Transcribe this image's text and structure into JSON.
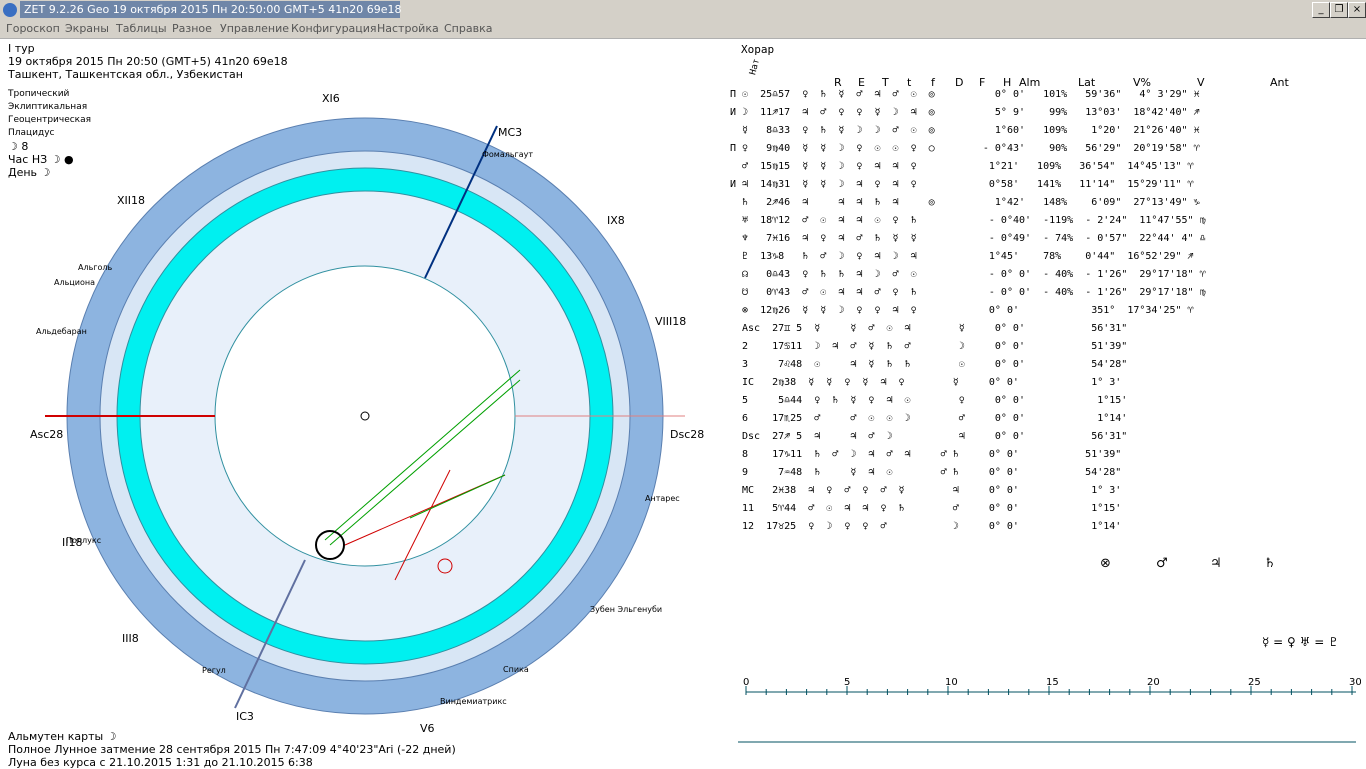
{
  "window": {
    "title": "ZET 9.2.26 Geo   19 октября 2015  Пн  20:50:00 GMT+5 41n20  69e18",
    "buttons": [
      "_",
      "❐",
      "×"
    ]
  },
  "menu": [
    "Гороскоп",
    "Экраны",
    "Таблицы",
    "Разное",
    "Управление",
    "Конфигурация",
    "Настройка",
    "Справка"
  ],
  "header": {
    "round": "I тур",
    "datetime": "19 октября 2015  Пн  20:50 (GMT+5) 41n20  69e18",
    "place": "Ташкент, Ташкентская обл., Узбекистан",
    "zodiac": "Тропический",
    "coords": "Эклиптикальная",
    "center": "Геоцентрическая",
    "houses": "Плацидус",
    "moon_day": "☽  8",
    "hour": "Час НЗ ☽ ●",
    "day": "День ☽"
  },
  "chart": {
    "house_labels": [
      "XI6",
      "MC3",
      "XII18",
      "IX8",
      "VIII18",
      "Asc28",
      "Dsc28",
      "II18",
      "III8",
      "IC3",
      "V6",
      "Зубен Эльгенуби"
    ],
    "stars": [
      "Фомальгаут",
      "Альголь",
      "Альциона",
      "Альдебаран",
      "Поллукс",
      "Регул",
      "Спика",
      "Виндемиатрикс",
      "Антарес",
      "Зубен Эльгенуби"
    ]
  },
  "horar": {
    "title": "Хорар",
    "nat_label": "Нат",
    "columns": [
      "R",
      "E",
      "T",
      "t",
      "f",
      "D",
      "F",
      "H",
      "Alm",
      "Lat",
      "V%",
      "V",
      "Ant"
    ],
    "rows": [
      "П ☉  25♎57  ♀  ♄  ☿  ♂  ♃  ♂  ☉  ◎          0° 0'   101%   59'36\"   4° 3'29\" ♓",
      "И ☽  11♐17  ♃  ♂  ♀  ♀  ☿  ☽  ♃  ◎          5° 9'    99%   13°03'  18°42'40\" ♐",
      "  ☿   8♎33  ♀  ♄  ☿  ☽  ☽  ♂  ☉  ◎          1°60'   109%    1°20'  21°26'40\" ♓",
      "П ♀   9♍40  ☿  ☿  ☽  ♀  ☉  ☉  ♀  ○        - 0°43'    90%   56'29\"  20°19'58\" ♈",
      "  ♂  15♍15  ☿  ☿  ☽  ♀  ♃  ♃  ♀            1°21'   109%   36'54\"  14°45'13\" ♈",
      "И ♃  14♍31  ☿  ☿  ☽  ♃  ♀  ♃  ♀            0°58'   141%   11'14\"  15°29'11\" ♈",
      "  ♄   2♐46  ♃     ♃  ♃  ♄  ♃     ◎          1°42'   148%    6'09\"  27°13'49\" ♑",
      "  ♅  18♈12  ♂  ☉  ♃  ♃  ☉  ♀  ♄            - 0°40'  -119%  - 2'24\"  11°47'55\" ♍",
      "  ♆   7♓16  ♃  ♀  ♃  ♂  ♄  ☿  ☿            - 0°49'  - 74%  - 0'57\"  22°44' 4\" ♎",
      "  ♇  13♑8   ♄  ♂  ☽  ♀  ♃  ☽  ♃            1°45'    78%    0'44\"  16°52'29\" ♐",
      "  ☊   0♎43  ♀  ♄  ♄  ♃  ☽  ♂  ☉            - 0° 0'  - 40%  - 1'26\"  29°17'18\" ♈",
      "  ☋   0♈43  ♂  ☉  ♃  ♃  ♂  ♀  ♄            - 0° 0'  - 40%  - 1'26\"  29°17'18\" ♍",
      "  ⊗  12♍26  ☿  ☿  ☽  ♀  ♀  ♃  ♀            0° 0'            351°  17°34'25\" ♈"
    ],
    "house_rows": [
      "Asc  27♊ 5  ☿     ☿  ♂  ☉  ♃        ☿     0° 0'           56'31\"",
      "2    17♋11  ☽  ♃  ♂  ☿  ♄  ♂        ☽     0° 0'           51'39\"",
      "3     7♌48  ☉     ♃  ☿  ♄  ♄        ☉     0° 0'           54'28\"",
      "IC   2♍38  ☿  ☿  ♀  ☿  ♃  ♀        ☿     0° 0'            1° 3'",
      "5     5♎44  ♀  ♄  ☿  ♀  ♃  ☉        ♀     0° 0'            1°15'",
      "6    17♏25  ♂     ♂  ☉  ☉  ☽        ♂     0° 0'            1°14'",
      "Dsc  27♐ 5  ♃     ♃  ♂  ☽           ♃     0° 0'           56'31\"",
      "8    17♑11  ♄  ♂  ☽  ♃  ♂  ♃     ♂ ♄     0° 0'           51'39\"",
      "9     7♒48  ♄     ☿  ♃  ☉        ♂ ♄     0° 0'           54'28\"",
      "MC   2♓38  ♃  ♀  ♂  ♀  ♂  ☿        ♃     0° 0'            1° 3'",
      "11   5♈44  ♂  ☉  ♃  ♃  ♀  ♄        ♂     0° 0'            1°15'",
      "12  17♉25  ♀  ☽  ♀  ♀  ♂           ☽     0° 0'            1°14'"
    ],
    "almuten_blocks": [
      "⊗",
      "♂",
      "♃",
      "♄"
    ],
    "equation": "☿ = ♀  ♅ = ♇"
  },
  "scale": {
    "ticks": [
      "0",
      "5",
      "10",
      "15",
      "20",
      "25",
      "30"
    ]
  },
  "footer": {
    "almuten": "Альмутен карты  ☽",
    "eclipse": "Полное Лунное затмение 28 сентября 2015 Пн  7:47:09  4°40'23\"Ari (-22 дней)",
    "void_moon": "Луна без курса с 21.10.2015  1:31 до 21.10.2015  6:38"
  },
  "colors": {
    "cyan": "#00f0f0",
    "blue_ring": "#8db4e0",
    "red": "#d00000",
    "green": "#00a000"
  }
}
